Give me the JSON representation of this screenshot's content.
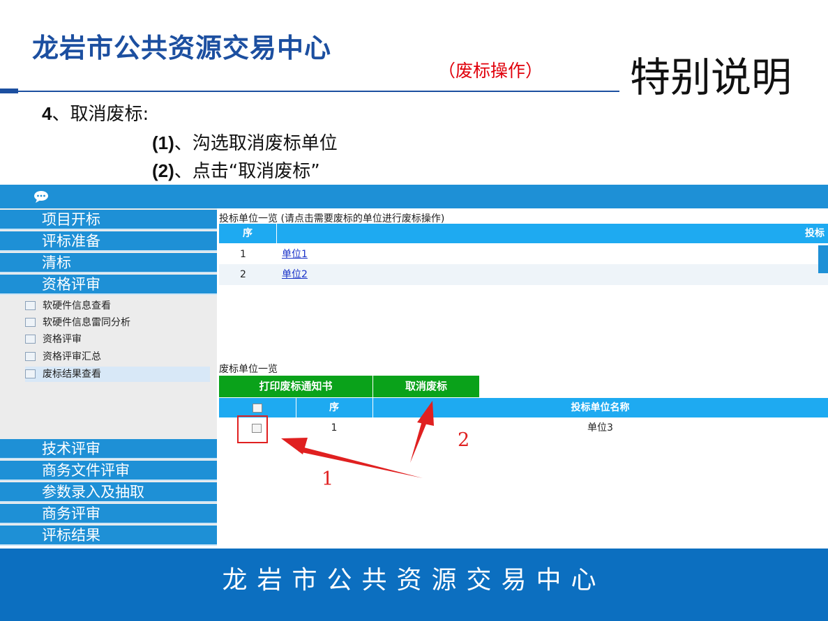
{
  "header": {
    "org_title": "龙岩市公共资源交易中心",
    "subtitle": "（废标操作）",
    "special_note": "特别说明"
  },
  "instructions": {
    "step_number": "4",
    "step_title": "、取消废标:",
    "sub1_num": "(1)",
    "sub1_text": "、沟选取消废标单位",
    "sub2_num": "(2)",
    "sub2_text": "、点击“取消废标”"
  },
  "sidebar": {
    "top_items": [
      "项目开标",
      "评标准备",
      "清标",
      "资格评审"
    ],
    "sub_items": [
      "软硬件信息查看",
      "软硬件信息雷同分析",
      "资格评审",
      "资格评审汇总",
      "废标结果查看"
    ],
    "bottom_items": [
      "技术评审",
      "商务文件评审",
      "参数录入及抽取",
      "商务评审",
      "评标结果"
    ]
  },
  "bidders_table": {
    "caption": "投标单位一览 (请点击需要废标的单位进行废标操作)",
    "col_seq": "序",
    "col_name": "投标",
    "rows": [
      {
        "seq": "1",
        "name": "单位1"
      },
      {
        "seq": "2",
        "name": "单位2"
      }
    ]
  },
  "invalid_table": {
    "caption": "废标单位一览",
    "print_button": "打印废标通知书",
    "cancel_button": "取消废标",
    "col_seq": "序",
    "col_name": "投标单位名称",
    "rows": [
      {
        "seq": "1",
        "name": "单位3"
      }
    ]
  },
  "annotations": {
    "label1": "1",
    "label2": "2"
  },
  "footer": {
    "text": "龙岩市公共资源交易中心"
  },
  "colors": {
    "brand_blue": "#1c4fa0",
    "menu_blue": "#1e90d6",
    "table_header": "#1eaaf1",
    "button_green": "#0aa21a",
    "annotation_red": "#e02020",
    "footer_blue": "#0c6fc0"
  }
}
